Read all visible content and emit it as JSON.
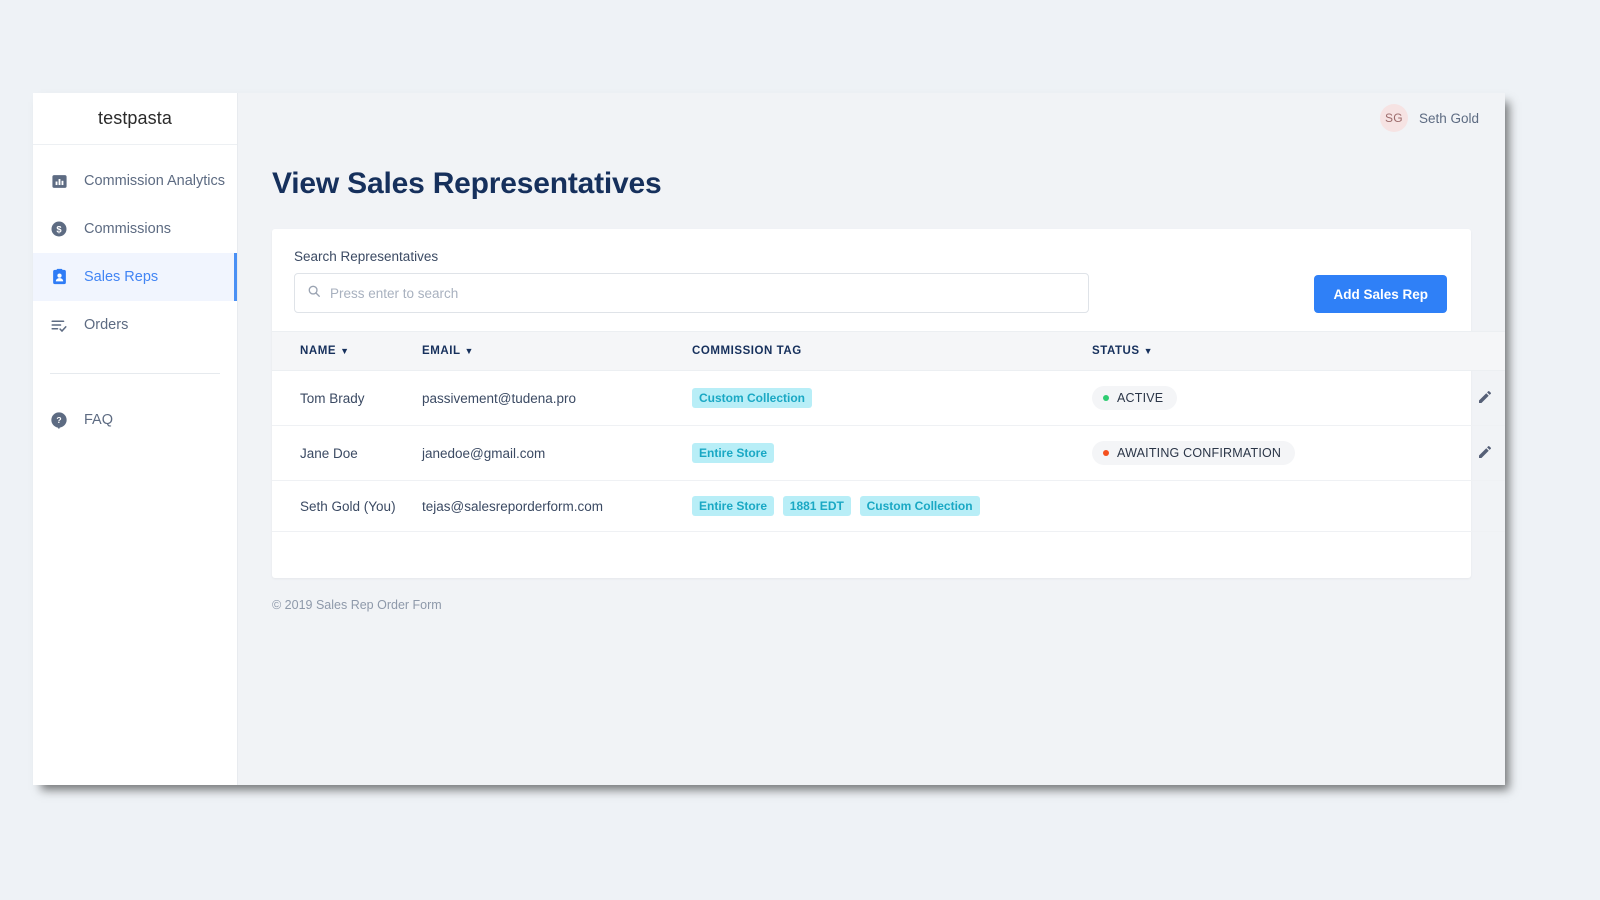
{
  "brand": {
    "name": "testpasta"
  },
  "sidebar": {
    "items": [
      {
        "label": "Commission Analytics",
        "icon": "bar-chart-icon",
        "active": false
      },
      {
        "label": "Commissions",
        "icon": "dollar-circle-icon",
        "active": false
      },
      {
        "label": "Sales Reps",
        "icon": "id-badge-icon",
        "active": true
      },
      {
        "label": "Orders",
        "icon": "list-check-icon",
        "active": false
      }
    ],
    "footer_items": [
      {
        "label": "FAQ",
        "icon": "question-circle-icon"
      }
    ]
  },
  "topbar": {
    "avatar_initials": "SG",
    "user_name": "Seth Gold"
  },
  "page": {
    "title": "View Sales Representatives",
    "copyright": "© 2019 Sales Rep Order Form"
  },
  "search": {
    "label": "Search Representatives",
    "placeholder": "Press enter to search",
    "value": "",
    "icon": "search-icon"
  },
  "actions": {
    "add_sales_rep": "Add Sales Rep"
  },
  "table": {
    "columns": [
      {
        "label": "NAME",
        "sortable": true
      },
      {
        "label": "EMAIL",
        "sortable": true
      },
      {
        "label": "COMMISSION TAG",
        "sortable": false
      },
      {
        "label": "STATUS",
        "sortable": true
      }
    ],
    "rows": [
      {
        "name": "Tom Brady",
        "email": "passivement@tudena.pro",
        "tags": [
          "Custom Collection"
        ],
        "status": {
          "label": "ACTIVE",
          "color": "#2ecc71"
        },
        "can_edit": true,
        "can_delete": true
      },
      {
        "name": "Jane Doe",
        "email": "janedoe@gmail.com",
        "tags": [
          "Entire Store"
        ],
        "status": {
          "label": "AWAITING CONFIRMATION",
          "color": "#f4501e"
        },
        "can_edit": true,
        "can_delete": true
      },
      {
        "name": "Seth Gold (You)",
        "email": "tejas@salesreporderform.com",
        "tags": [
          "Entire Store",
          "1881 EDT",
          "Custom Collection"
        ],
        "status": null,
        "can_edit": true,
        "can_delete": false
      }
    ]
  },
  "colors": {
    "accent": "#2f80f7",
    "title": "#16305c",
    "tag_bg": "#b8eef7",
    "tag_text": "#1aa8c4",
    "page_bg": "#f1f3f6",
    "desktop_bg": "#eef2f6"
  }
}
